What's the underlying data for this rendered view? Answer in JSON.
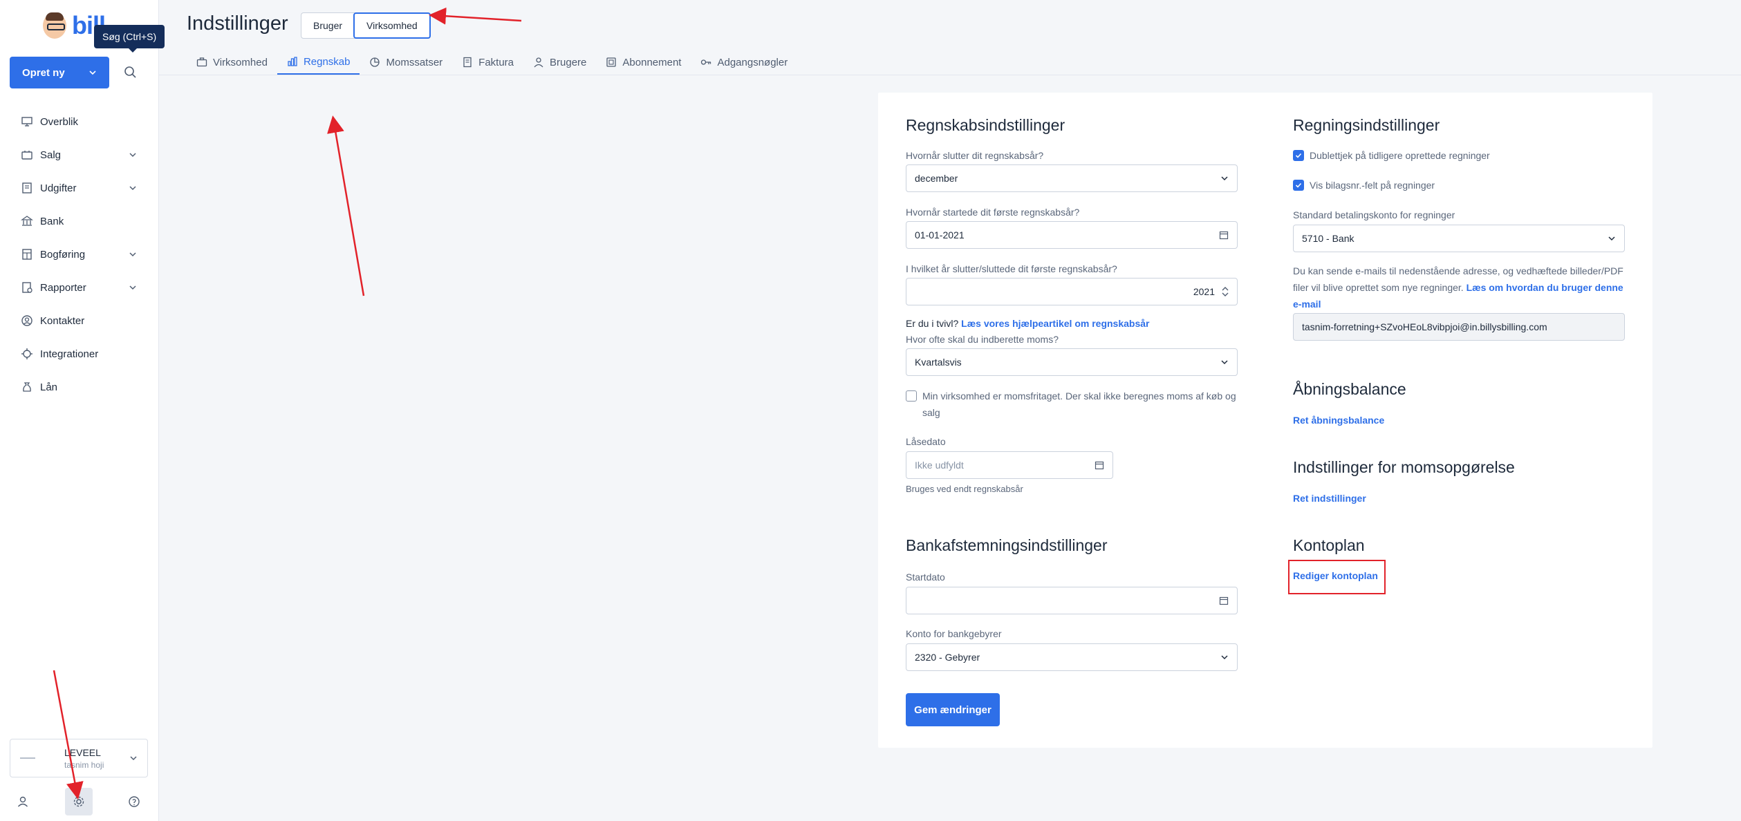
{
  "sidebar": {
    "logo_text": "bill",
    "tooltip": "Søg (Ctrl+S)",
    "create_button": "Opret ny",
    "nav": [
      {
        "label": "Overblik",
        "icon": "monitor-icon",
        "chevron": false
      },
      {
        "label": "Salg",
        "icon": "tag-icon",
        "chevron": true
      },
      {
        "label": "Udgifter",
        "icon": "receipt-icon",
        "chevron": true
      },
      {
        "label": "Bank",
        "icon": "bank-icon",
        "chevron": false
      },
      {
        "label": "Bogføring",
        "icon": "ledger-icon",
        "chevron": true
      },
      {
        "label": "Rapporter",
        "icon": "report-icon",
        "chevron": true
      },
      {
        "label": "Kontakter",
        "icon": "contact-icon",
        "chevron": false
      },
      {
        "label": "Integrationer",
        "icon": "integration-icon",
        "chevron": false
      },
      {
        "label": "Lån",
        "icon": "money-bag-icon",
        "chevron": false
      }
    ],
    "account": {
      "name": "LEVEEL",
      "user": "tasnim hoji"
    }
  },
  "header": {
    "title": "Indstillinger",
    "segment": [
      "Bruger",
      "Virksomhed"
    ],
    "tabs": [
      {
        "label": "Virksomhed",
        "icon": "briefcase-icon"
      },
      {
        "label": "Regnskab",
        "icon": "bar-chart-icon"
      },
      {
        "label": "Momssatser",
        "icon": "pie-icon"
      },
      {
        "label": "Faktura",
        "icon": "invoice-icon"
      },
      {
        "label": "Brugere",
        "icon": "user-icon"
      },
      {
        "label": "Abonnement",
        "icon": "subscription-icon"
      },
      {
        "label": "Adgangsnøgler",
        "icon": "key-icon"
      }
    ]
  },
  "accounting": {
    "title": "Regnskabsindstillinger",
    "fiscal_end_label": "Hvornår slutter dit regnskabsår?",
    "fiscal_end_value": "december",
    "fiscal_start_label": "Hvornår startede dit første regnskabsår?",
    "fiscal_start_value": "01-01-2021",
    "first_year_label": "I hvilket år slutter/sluttede dit første regnskabsår?",
    "first_year_value": "2021",
    "doubt_text": "Er du i tvivl?",
    "doubt_link": "Læs vores hjælpeartikel om regnskabsår",
    "vat_period_label": "Hvor ofte skal du indberette moms?",
    "vat_period_value": "Kvartalsvis",
    "vat_exempt_text": "Min virksomhed er momsfritaget. Der skal ikke beregnes moms af køb og salg",
    "lock_date_label": "Låsedato",
    "lock_date_placeholder": "Ikke udfyldt",
    "lock_date_hint": "Bruges ved endt regnskabsår"
  },
  "bank_reconciliation": {
    "title": "Bankafstemningsindstillinger",
    "start_label": "Startdato",
    "fee_label": "Konto for bankgebyrer",
    "fee_value": "2320 - Gebyrer",
    "save_button": "Gem ændringer"
  },
  "bills": {
    "title": "Regningsindstillinger",
    "dup_check": "Dublettjek på tidligere oprettede regninger",
    "show_voucher": "Vis bilagsnr.-felt på regninger",
    "payment_account_label": "Standard betalingskonto for regninger",
    "payment_account_value": "5710 - Bank",
    "email_info": "Du kan sende e-mails til nedenstående adresse, og vedhæftede billeder/PDF filer vil blive oprettet som nye regninger.",
    "email_info_link": "Læs om hvordan du bruger denne e-mail",
    "email_value": "tasnim-forretning+SZvoHEoL8vibpjoi@in.billysbilling.com"
  },
  "opening_balance": {
    "title": "Åbningsbalance",
    "link": "Ret åbningsbalance"
  },
  "vat_report": {
    "title": "Indstillinger for momsopgørelse",
    "link": "Ret indstillinger"
  },
  "chart_of_accounts": {
    "title": "Kontoplan",
    "link": "Rediger kontoplan"
  },
  "colors": {
    "accent": "#2e6fe8",
    "annotation": "#e2222a"
  }
}
